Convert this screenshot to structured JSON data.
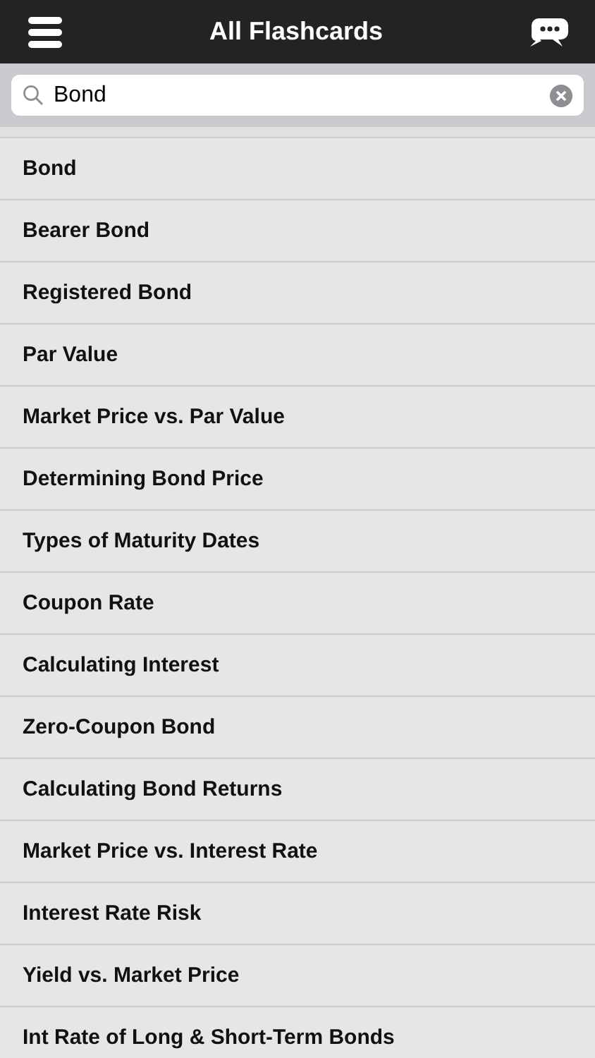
{
  "header": {
    "title": "All Flashcards"
  },
  "search": {
    "value": "Bond"
  },
  "cards": [
    {
      "title": "Bond"
    },
    {
      "title": "Bearer Bond"
    },
    {
      "title": "Registered Bond"
    },
    {
      "title": "Par Value"
    },
    {
      "title": "Market Price vs. Par Value"
    },
    {
      "title": "Determining Bond Price"
    },
    {
      "title": "Types of Maturity Dates"
    },
    {
      "title": "Coupon Rate"
    },
    {
      "title": "Calculating Interest"
    },
    {
      "title": "Zero-Coupon Bond"
    },
    {
      "title": "Calculating Bond Returns"
    },
    {
      "title": "Market Price vs. Interest Rate"
    },
    {
      "title": "Interest Rate Risk"
    },
    {
      "title": "Yield vs. Market Price"
    },
    {
      "title": "Int Rate of Long & Short-Term Bonds"
    }
  ]
}
